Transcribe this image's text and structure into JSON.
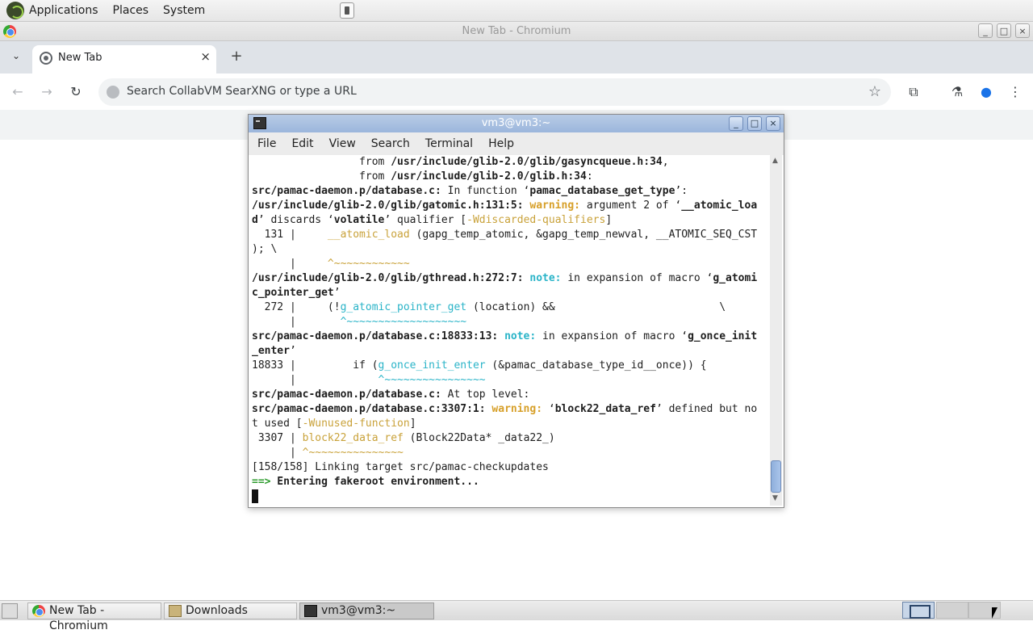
{
  "top_panel": {
    "menus": [
      "Applications",
      "Places",
      "System"
    ]
  },
  "chromium": {
    "window_title": "New Tab - Chromium",
    "tab": {
      "label": "New Tab",
      "close": "×"
    },
    "new_tab": "+",
    "omnibox_placeholder": "Search CollabVM SearXNG or type a URL",
    "wm_buttons": {
      "minimize": "_",
      "maximize": "□",
      "close": "×"
    }
  },
  "terminal": {
    "title": "vm3@vm3:~",
    "menus": [
      "File",
      "Edit",
      "View",
      "Search",
      "Terminal",
      "Help"
    ],
    "lines": {
      "l1a": "                 from ",
      "l1b": "/usr/include/glib-2.0/glib/gasyncqueue.h:34",
      "l1c": ",",
      "l2a": "                 from ",
      "l2b": "/usr/include/glib-2.0/glib.h:34",
      "l2c": ":",
      "l3a": "src/pamac-daemon.p/database.c:",
      "l3b": " In function ‘",
      "l3c": "pamac_database_get_type",
      "l3d": "’:",
      "l4a": "/usr/include/glib-2.0/glib/gatomic.h:131:5:",
      "l4b": " warning: ",
      "l4c": "argument 2 of ‘",
      "l4d": "__atomic_loa",
      "l5a": "d",
      "l5b": "’ discards ‘",
      "l5c": "volatile",
      "l5d": "’ qualifier [",
      "l5e": "-Wdiscarded-qualifiers",
      "l5f": "]",
      "l6a": "  131 |     ",
      "l6b": "__atomic_load",
      "l6c": " (gapg_temp_atomic, &gapg_temp_newval, __ATOMIC_SEQ_CST",
      "l7": "); \\",
      "l8a": "      |     ",
      "l8b": "^~~~~~~~~~~~~",
      "l9a": "/usr/include/glib-2.0/glib/gthread.h:272:7:",
      "l9b": " note: ",
      "l9c": "in expansion of macro ‘",
      "l9d": "g_atomi",
      "l10a": "c_pointer_get",
      "l10b": "’",
      "l11a": "  272 |     (!",
      "l11b": "g_atomic_pointer_get",
      "l11c": " (location) &&                          \\",
      "l12a": "      |       ",
      "l12b": "^~~~~~~~~~~~~~~~~~~~",
      "l13a": "src/pamac-daemon.p/database.c:18833:13:",
      "l13b": " note: ",
      "l13c": "in expansion of macro ‘",
      "l13d": "g_once_init",
      "l14a": "_enter",
      "l14b": "’",
      "l15a": "18833 |         if (",
      "l15b": "g_once_init_enter",
      "l15c": " (&pamac_database_type_id__once)) {",
      "l16a": "      |             ",
      "l16b": "^~~~~~~~~~~~~~~~~",
      "l17a": "src/pamac-daemon.p/database.c:",
      "l17b": " At top level:",
      "l18a": "src/pamac-daemon.p/database.c:3307:1:",
      "l18b": " warning: ",
      "l18c": "‘",
      "l18d": "block22_data_ref",
      "l18e": "’ defined but no",
      "l19a": "t used [",
      "l19b": "-Wunused-function",
      "l19c": "]",
      "l20a": " 3307 | ",
      "l20b": "block22_data_ref",
      "l20c": " (Block22Data* _data22_)",
      "l21a": "      | ",
      "l21b": "^~~~~~~~~~~~~~~~",
      "l22": "[158/158] Linking target src/pamac-checkupdates",
      "l23a": "==>",
      "l23b": " Entering fakeroot environment..."
    }
  },
  "taskbar": {
    "tasks": [
      "New Tab - Chromium",
      "Downloads",
      "vm3@vm3:~"
    ]
  }
}
